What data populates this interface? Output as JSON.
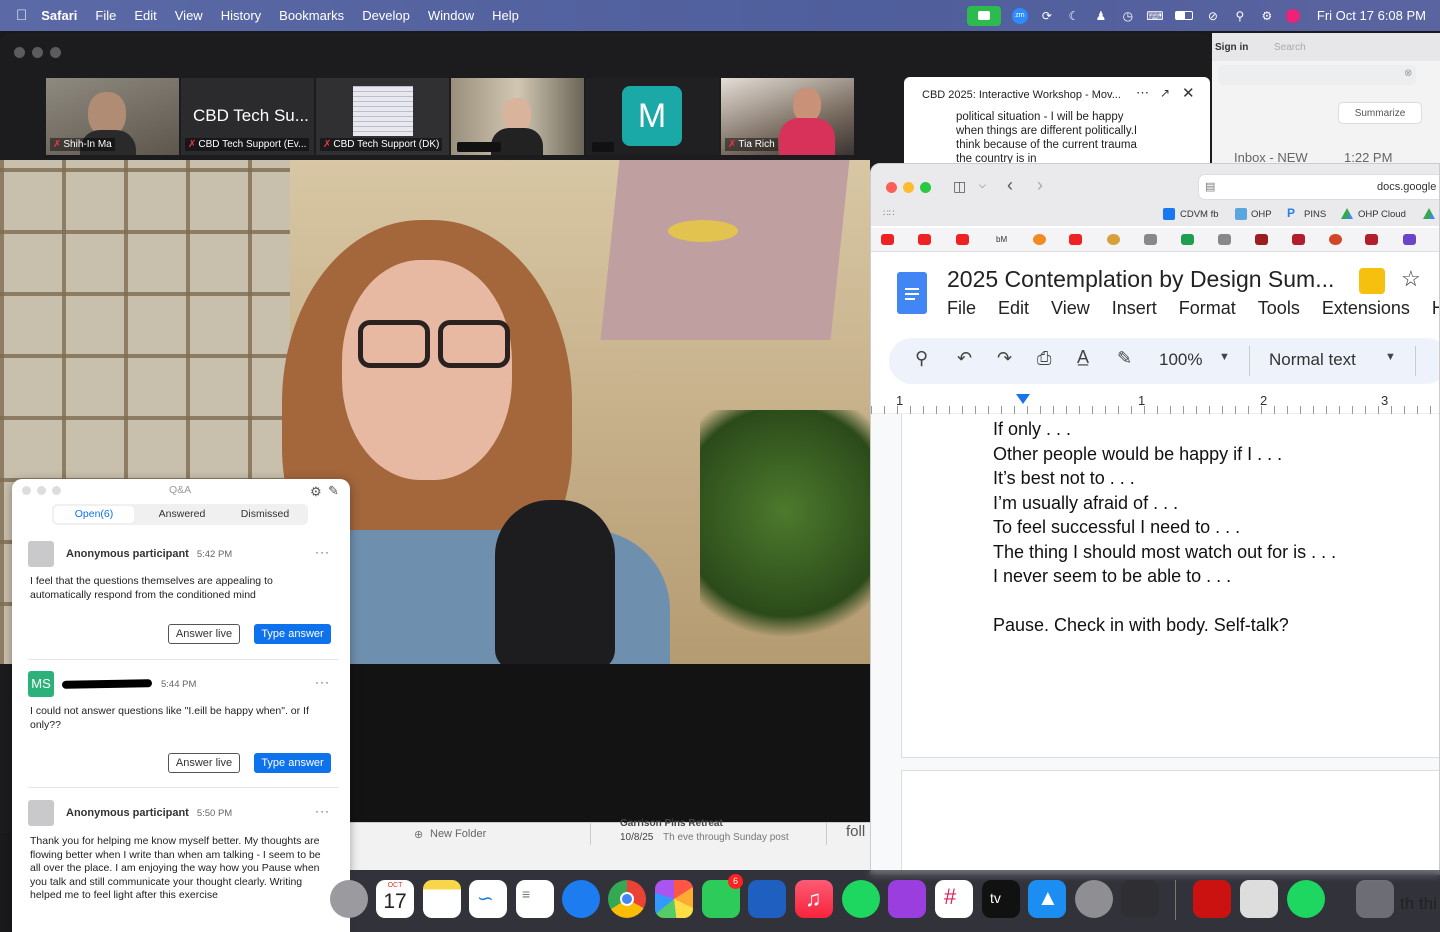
{
  "menubar": {
    "app": "Safari",
    "items": [
      "File",
      "Edit",
      "View",
      "History",
      "Bookmarks",
      "Develop",
      "Window",
      "Help"
    ],
    "datetime": "Fri Oct 17  6:08 PM",
    "zoom_badge": "zm"
  },
  "zoom": {
    "participants": [
      {
        "name": "Shih-In Ma"
      },
      {
        "name": "CBD Tech Support (Ev...",
        "title": "CBD Tech Su..."
      },
      {
        "name": "CBD Tech Support (DK)"
      },
      {
        "name": ""
      },
      {
        "name": "",
        "initial": "M"
      },
      {
        "name": "Tia Rich"
      }
    ],
    "chat": {
      "title": "CBD 2025: Interactive Workshop - Mov...",
      "message": "political situation - I will be happy when things are different politically.I think because of the current trauma the country is in"
    }
  },
  "mail": {
    "sign_in": "Sign in",
    "search": "Search",
    "summarize": "Summarize",
    "inbox": "Inbox - NEW",
    "time": "1:22 PM"
  },
  "safari": {
    "url": "docs.google",
    "bookmarks": [
      "CDVM fb",
      "OHP",
      "PINS",
      "OHP Cloud"
    ],
    "fav_text": "bM"
  },
  "docs": {
    "title": "2025 Contemplation by Design Sum...",
    "menu": [
      "File",
      "Edit",
      "View",
      "Insert",
      "Format",
      "Tools",
      "Extensions",
      "He"
    ],
    "zoom": "100%",
    "style": "Normal text",
    "ruler": [
      "1",
      "1",
      "2",
      "3"
    ],
    "lines": [
      "If only . . .",
      "Other people would be happy if I . . .",
      "It’s best not to . . .",
      "I’m usually afraid of . . .",
      "To feel successful I need to . . .",
      "The thing I should most watch out for is . . .",
      "I never seem to be able to . . .",
      "",
      "Pause. Check in with body. Self-talk?"
    ]
  },
  "qa": {
    "title": "Q&A",
    "tabs": [
      "Open(6)",
      "Answered",
      "Dismissed"
    ],
    "answer_live": "Answer live",
    "type_answer": "Type answer",
    "questions": [
      {
        "name": "Anonymous participant",
        "time": "5:42 PM",
        "initials": "",
        "text": "I feel that the questions themselves are appealing to automatically respond from the conditioned mind"
      },
      {
        "name": "",
        "time": "5:44 PM",
        "initials": "MS",
        "text": "I could not answer questions like \"I.eill be happy when\". or If only??"
      },
      {
        "name": "Anonymous participant",
        "time": "5:50 PM",
        "initials": "",
        "text": "Thank you for helping me know myself better. My thoughts are flowing better when I write than when am talking - I seem to be all over the place. I am enjoying the way how you Pause when you talk and still communicate your thought clearly.  Writing helped me to feel light after this exercise"
      }
    ]
  },
  "finder": {
    "new_folder": "New Folder",
    "event_title": "Garrison Pins Retreat",
    "event_date": "10/8/25",
    "event_desc": "Th eve through Sunday post",
    "partial": "foll"
  },
  "dock": {
    "calendar_month": "OCT",
    "calendar_day": "17",
    "facetime_badge": "6",
    "tv_label": "tv",
    "partial_text": "th thi"
  }
}
